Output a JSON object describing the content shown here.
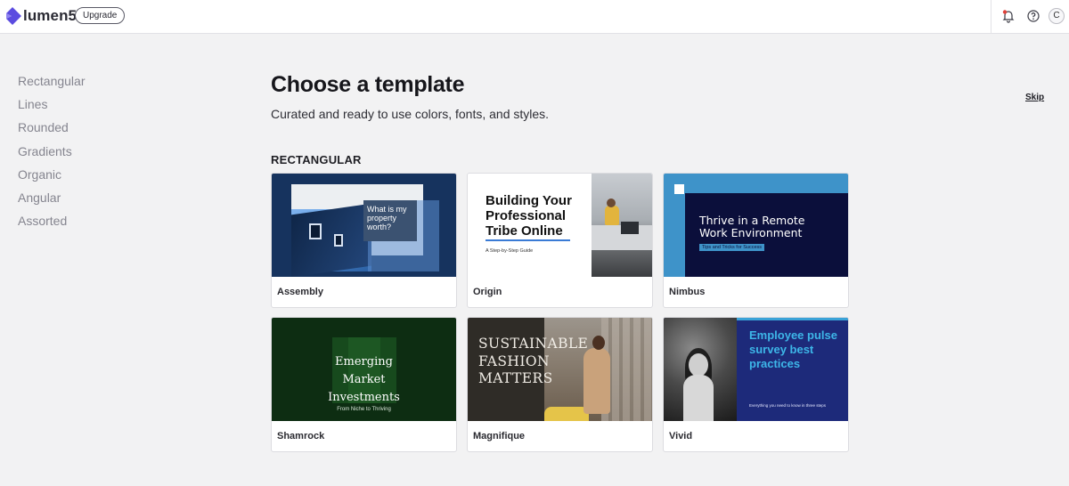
{
  "app": {
    "name": "lumen5",
    "upgrade_label": "Upgrade",
    "avatar_initial": "C",
    "brand_color": "#5b4ce0"
  },
  "sidebar": {
    "items": [
      {
        "label": "Rectangular"
      },
      {
        "label": "Lines"
      },
      {
        "label": "Rounded"
      },
      {
        "label": "Gradients"
      },
      {
        "label": "Organic"
      },
      {
        "label": "Angular"
      },
      {
        "label": "Assorted"
      }
    ]
  },
  "main": {
    "title": "Choose a template",
    "subtitle": "Curated and ready to use colors, fonts, and styles.",
    "skip_label": "Skip",
    "section_title": "RECTANGULAR",
    "templates": [
      {
        "name": "Assembly",
        "thumb_text": "What is my property worth?"
      },
      {
        "name": "Origin",
        "thumb_text": "Building Your Professional Tribe Online",
        "thumb_subtext": "A Step-by-Step Guide"
      },
      {
        "name": "Nimbus",
        "thumb_text": "Thrive in a Remote Work Environment",
        "thumb_subtext": "Tips and Tricks for Success"
      },
      {
        "name": "Shamrock",
        "thumb_text": "Emerging Market Investments",
        "thumb_subtext": "From Niche to Thriving"
      },
      {
        "name": "Magnifique",
        "thumb_text": "SUSTAINABLE FASHION MATTERS"
      },
      {
        "name": "Vivid",
        "thumb_text": "Employee pulse survey best practices",
        "thumb_subtext": "Everything you need to know in three steps"
      }
    ]
  }
}
